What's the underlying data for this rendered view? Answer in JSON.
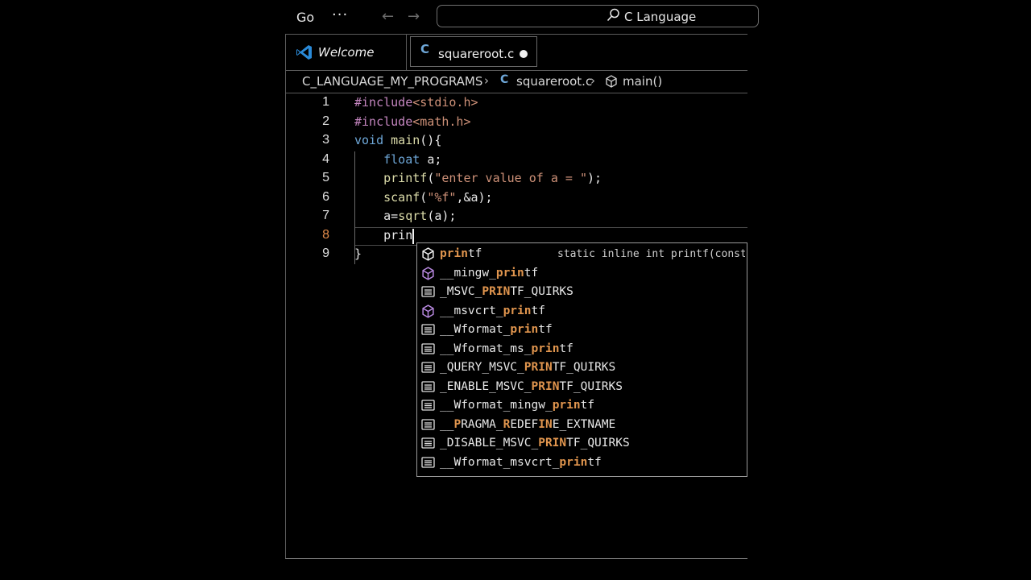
{
  "titlebar": {
    "menu_go": "Go",
    "menu_more": "···",
    "search_text": "C Language"
  },
  "tabs": [
    {
      "label": "Welcome",
      "icon": "vscode-icon"
    },
    {
      "label": "squareroot.c",
      "icon": "c-file-icon",
      "dirty": true,
      "c_glyph": "C"
    }
  ],
  "breadcrumb": {
    "folder": "C_LANGUAGE_MY_PROGRAMS",
    "sep": "›",
    "file": "squareroot.c",
    "c_glyph": "C",
    "symbol": "main()"
  },
  "editor": {
    "line_numbers": [
      "1",
      "2",
      "3",
      "4",
      "5",
      "6",
      "7",
      "8",
      "9"
    ],
    "active_line": 8,
    "lines": [
      [
        {
          "t": "#include",
          "c": "kw-pre"
        },
        {
          "t": "<stdio.h>",
          "c": "str"
        }
      ],
      [
        {
          "t": "#include",
          "c": "kw-pre"
        },
        {
          "t": "<math.h>",
          "c": "str"
        }
      ],
      [
        {
          "t": "void ",
          "c": "kw"
        },
        {
          "t": "main",
          "c": "fn"
        },
        {
          "t": "(){",
          "c": ""
        }
      ],
      [
        {
          "t": "    float ",
          "c": "kw"
        },
        {
          "t": "a;",
          "c": ""
        }
      ],
      [
        {
          "t": "    printf",
          "c": "fn"
        },
        {
          "t": "(",
          "c": ""
        },
        {
          "t": "\"enter value of a = \"",
          "c": "str"
        },
        {
          "t": ");",
          "c": ""
        }
      ],
      [
        {
          "t": "    scanf",
          "c": "fn"
        },
        {
          "t": "(",
          "c": ""
        },
        {
          "t": "\"%f\"",
          "c": "str"
        },
        {
          "t": ",&a);",
          "c": ""
        }
      ],
      [
        {
          "t": "    a=",
          "c": ""
        },
        {
          "t": "sqrt",
          "c": "fn"
        },
        {
          "t": "(a);",
          "c": ""
        }
      ],
      [
        {
          "t": "    prin",
          "c": ""
        }
      ],
      [
        {
          "t": "}",
          "c": ""
        }
      ]
    ]
  },
  "suggestions": {
    "detail": "static inline int printf(const",
    "items": [
      {
        "pre": "",
        "hl": "prin",
        "post": "tf",
        "icon": "function"
      },
      {
        "pre": "__mingw_",
        "hl": "prin",
        "post": "tf",
        "icon": "function"
      },
      {
        "pre": "_MSVC_",
        "hl": "PRIN",
        "post": "TF_QUIRKS",
        "icon": "text"
      },
      {
        "pre": "__msvcrt_",
        "hl": "prin",
        "post": "tf",
        "icon": "function"
      },
      {
        "pre": "__Wformat_",
        "hl": "prin",
        "post": "tf",
        "icon": "text"
      },
      {
        "pre": "__Wformat_ms_",
        "hl": "prin",
        "post": "tf",
        "icon": "text"
      },
      {
        "pre": "_QUERY_MSVC_",
        "hl": "PRIN",
        "post": "TF_QUIRKS",
        "icon": "text"
      },
      {
        "pre": "_ENABLE_MSVC_",
        "hl": "PRIN",
        "post": "TF_QUIRKS",
        "icon": "text"
      },
      {
        "pre": "__Wformat_mingw_",
        "hl": "prin",
        "post": "tf",
        "icon": "text"
      },
      {
        "pre": "__",
        "hl": "P",
        "post": "RAGMA_",
        "hl2": "R",
        "mid2": "EDEF",
        "hl3": "IN",
        "post3": "E_EXTNAME",
        "icon": "text"
      },
      {
        "pre": "_DISABLE_MSVC_",
        "hl": "PRIN",
        "post": "TF_QUIRKS",
        "icon": "text"
      },
      {
        "pre": "__Wformat_msvcrt_",
        "hl": "prin",
        "post": "tf",
        "icon": "text"
      }
    ]
  },
  "colors": {
    "accent_orange": "#e0954e",
    "keyword_blue": "#6ea7d8",
    "preprocessor_purple": "#c586c0",
    "string": "#ce9178",
    "function_yellow": "#dcdcaa"
  }
}
